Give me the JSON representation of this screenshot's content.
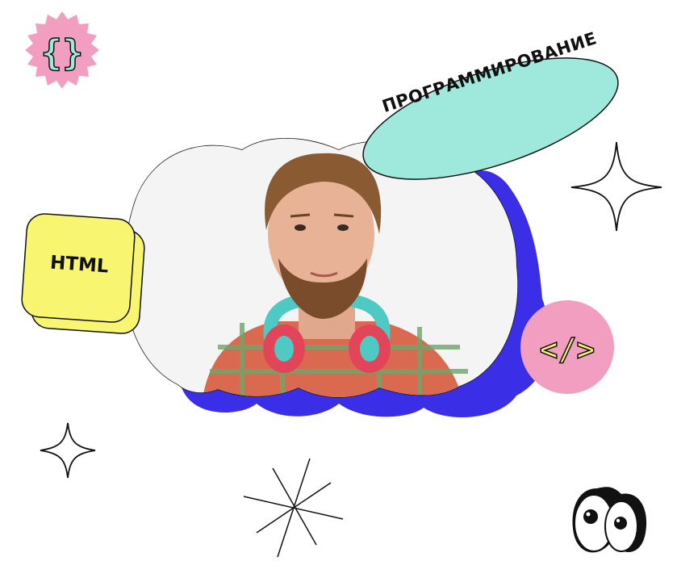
{
  "tags": {
    "programming": "ПРОГРАММИРОВАНИЕ",
    "html": "HTML"
  },
  "badges": {
    "curly_braces": "{}",
    "code_tag": "</>"
  },
  "colors": {
    "mint": "#9fe8dc",
    "yellow": "#f8f571",
    "pink": "#f29ec0",
    "blue": "#3a2fe6",
    "ink": "#111111"
  },
  "icons": [
    "sparkle-icon",
    "asterisk-icon",
    "eyes-icon",
    "curly-braces-icon",
    "code-tag-icon"
  ]
}
